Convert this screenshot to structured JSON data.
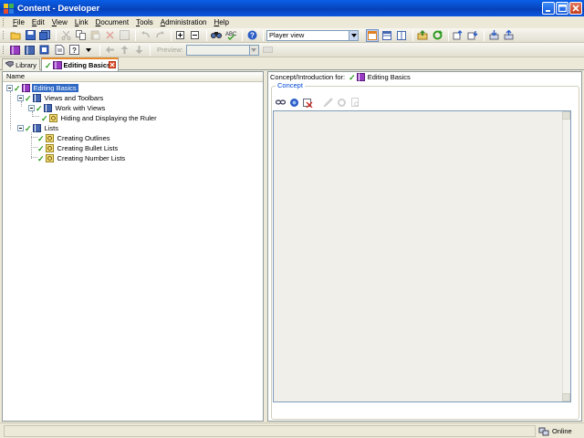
{
  "window": {
    "title": "Content - Developer"
  },
  "menu": {
    "items": [
      {
        "label": "File",
        "key": "F",
        "rest": "ile"
      },
      {
        "label": "Edit",
        "key": "E",
        "rest": "dit"
      },
      {
        "label": "View",
        "key": "V",
        "rest": "iew"
      },
      {
        "label": "Link",
        "key": "L",
        "rest": "ink"
      },
      {
        "label": "Document",
        "key": "D",
        "rest": "ocument"
      },
      {
        "label": "Tools",
        "key": "T",
        "rest": "ools"
      },
      {
        "label": "Administration",
        "key": "A",
        "rest": "dministration"
      },
      {
        "label": "Help",
        "key": "H",
        "rest": "elp"
      }
    ]
  },
  "toolbar1": {
    "view_select": "Player view"
  },
  "toolbar2": {
    "preview_label": "Preview:",
    "preview_select": ""
  },
  "tabs": {
    "library": "Library",
    "editing": "Editing Basics"
  },
  "outline": {
    "column_header": "Name",
    "nodes": [
      {
        "label": "Editing Basics",
        "level": 0,
        "selected": true
      },
      {
        "label": "Views and Toolbars",
        "level": 1
      },
      {
        "label": "Work with Views",
        "level": 2
      },
      {
        "label": "Hiding and Displaying the Ruler",
        "level": 3
      },
      {
        "label": "Lists",
        "level": 1
      },
      {
        "label": "Creating Outlines",
        "level": 2
      },
      {
        "label": "Creating Bullet Lists",
        "level": 2
      },
      {
        "label": "Creating Number Lists",
        "level": 2
      }
    ]
  },
  "concept": {
    "header_prefix": "Concept/Introduction for:",
    "header_target": "Editing Basics",
    "group_label": "Concept"
  },
  "status": {
    "connection": "Online"
  },
  "colors": {
    "titlebar": "#0a5fe8",
    "selection": "#316ac5",
    "check": "#2c9b1e",
    "group_label": "#0046d5"
  }
}
